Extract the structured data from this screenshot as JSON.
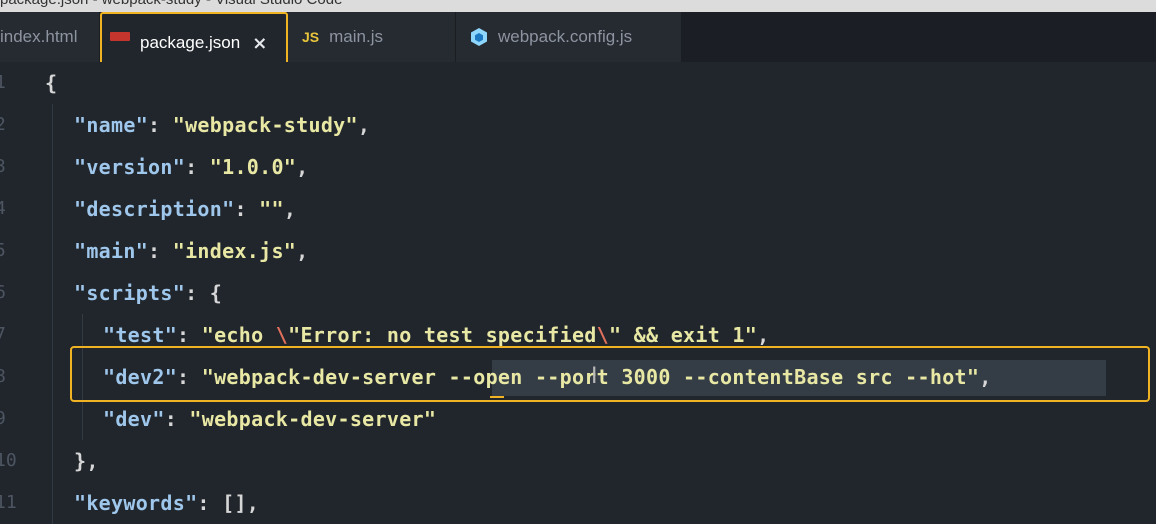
{
  "window": {
    "title": "package.json - webpack-study - Visual Studio Code"
  },
  "tabs": [
    {
      "label": "index.html",
      "icon": "html-file-icon",
      "active": false
    },
    {
      "label": "package.json",
      "icon": "npm-file-icon",
      "active": true,
      "close": "×"
    },
    {
      "label": "main.js",
      "icon": "js-file-icon",
      "icon_text": "JS",
      "active": false
    },
    {
      "label": "webpack.config.js",
      "icon": "webpack-icon",
      "active": false
    }
  ],
  "editor": {
    "line_numbers": [
      "1",
      "2",
      "3",
      "4",
      "5",
      "6",
      "7",
      "8",
      "9",
      "10",
      "11"
    ],
    "lines": {
      "l1": {
        "brace": "{"
      },
      "l2": {
        "key": "\"name\"",
        "colon": ": ",
        "value": "\"webpack-study\"",
        "tail": ","
      },
      "l3": {
        "key": "\"version\"",
        "colon": ": ",
        "value": "\"1.0.0\"",
        "tail": ","
      },
      "l4": {
        "key": "\"description\"",
        "colon": ": ",
        "value": "\"\"",
        "tail": ","
      },
      "l5": {
        "key": "\"main\"",
        "colon": ": ",
        "value": "\"index.js\"",
        "tail": ","
      },
      "l6": {
        "key": "\"scripts\"",
        "colon": ": ",
        "tail": "{"
      },
      "l7": {
        "key": "\"test\"",
        "colon": ": ",
        "v1": "\"echo ",
        "e1": "\\",
        "v2": "\"Error: no test specified",
        "e2": "\\",
        "v3": "\" && exit 1\"",
        "tail": ","
      },
      "l8": {
        "key": "\"dev2\"",
        "colon": ": ",
        "value": "\"webpack-dev-server --open --port 3000 --contentBase src --hot\"",
        "tail": ","
      },
      "l9": {
        "key": "\"dev\"",
        "colon": ": ",
        "value": "\"webpack-dev-server\""
      },
      "l10": {
        "brace": "},"
      },
      "l11": {
        "key": "\"keywords\"",
        "colon": ": ",
        "tail": "[],"
      }
    }
  },
  "colors": {
    "accent_highlight": "#f0b323",
    "editor_bg": "#21262d",
    "json_key": "#9fc7ec",
    "json_string": "#e8e8a4"
  }
}
